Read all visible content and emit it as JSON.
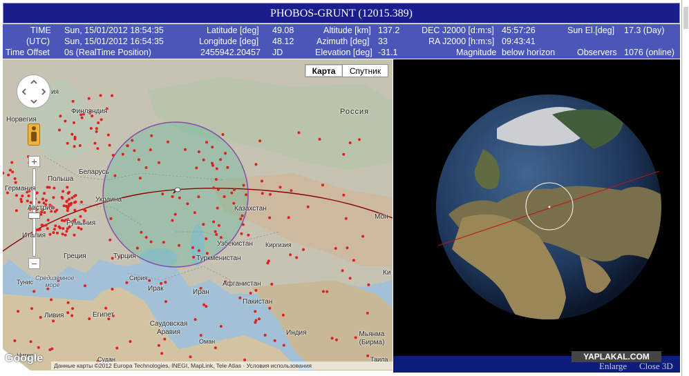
{
  "title": "PHOBOS-GRUNT (12015.389)",
  "info": {
    "time_label": "TIME",
    "time_value": "Sun, 15/01/2012 18:54:35",
    "utc_label": "(UTC)",
    "utc_value": "Sun, 15/01/2012 16:54:35",
    "offset_label": "Time Offset",
    "offset_value": "0s (RealTime Position)",
    "latitude_label": "Latitude [deg]",
    "latitude_value": "49.08",
    "longitude_label": "Longitude [deg]",
    "longitude_value": "48.12",
    "jd_value": "2455942.20457",
    "jd_label": "JD",
    "altitude_label": "Altitude [km]",
    "altitude_value": "137.2",
    "azimuth_label": "Azimuth [deg]",
    "azimuth_value": "33",
    "elevation_label": "Elevation [deg]",
    "elevation_value": "-31.1",
    "dec_label": "DEC J2000 [d:m:s]",
    "dec_value": "45:57:26",
    "ra_label": "RA J2000 [h:m:s]",
    "ra_value": "09:43:41",
    "magnitude_label": "Magnitude",
    "magnitude_value": "below horizon",
    "sun_label": "Sun El.[deg]",
    "sun_value": "17.3 (Day)",
    "observers_label": "Observers",
    "observers_value": "1076 (online)"
  },
  "map": {
    "type_map": "Карта",
    "type_satellite": "Спутник",
    "logo": "Google",
    "attribution": "Данные карты ©2012 Europa Technologies, INEGI, MapLink, Tele Atlas · Условия использования",
    "places": {
      "finland": "Финляндия",
      "norway": "Норвегия",
      "russia": "Россия",
      "belarus": "Беларусь",
      "poland": "Польша",
      "germany": "Германия",
      "ukraine": "Украина",
      "austria": "Австрия",
      "romania": "Румыния",
      "italy": "Италия",
      "greece": "Греция",
      "turkey": "Турция",
      "kazakhstan": "Казахстан",
      "uzbekistan": "Узбекистан",
      "kyrgyzstan": "Киргизия",
      "turkmenistan": "Туркменистан",
      "afghanistan": "Афганистан",
      "syria": "Сирия",
      "iraq": "Ирак",
      "iran": "Иран",
      "pakistan": "Пакистан",
      "tunisia": "Тунис",
      "mediterranean": "Средиземное море",
      "libya": "Ливия",
      "egypt": "Египет",
      "saudi_arabia": "Саудовская Аравия",
      "oman": "Оман",
      "india": "Индия",
      "myanmar": "Мьянма (Бирма)",
      "sudan": "Судан",
      "niger": "Нигер",
      "thailand": "Таила",
      "mongolia": "Мон",
      "china": "Ки",
      "latvia": "ия",
      "estonia": "ия",
      "denmark": "ия"
    }
  },
  "footer": {
    "watermark": "YAPLAKAL.COM",
    "enlarge": "Enlarge",
    "close3d": "Close 3D"
  },
  "colors": {
    "title_bar": "#1a1d8c",
    "info_bar": "#4a56b8",
    "observer_dot": "#e02020",
    "footprint": "#8a4aa8",
    "ground_track": "#8b0000"
  }
}
